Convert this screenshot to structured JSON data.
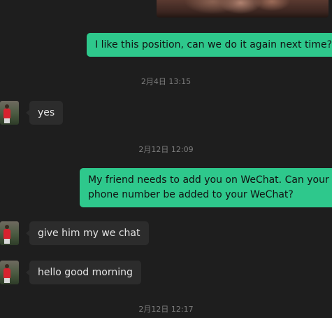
{
  "conversation": {
    "messages": [
      {
        "type": "image",
        "direction": "outgoing"
      },
      {
        "type": "text",
        "direction": "outgoing",
        "text": "I like this position, can we do it again next time?"
      },
      {
        "type": "timestamp",
        "text": "2月4日 13:15"
      },
      {
        "type": "text",
        "direction": "incoming",
        "text": "yes"
      },
      {
        "type": "timestamp",
        "text": "2月12日 12:09"
      },
      {
        "type": "text",
        "direction": "outgoing",
        "lines": [
          "My friend needs to add you on WeChat. Can your",
          "phone number be added to your WeChat?"
        ]
      },
      {
        "type": "text",
        "direction": "incoming",
        "text": "give him my we chat"
      },
      {
        "type": "text",
        "direction": "incoming",
        "text": "hello good morning"
      },
      {
        "type": "timestamp",
        "text": "2月12日 12:17"
      }
    ]
  },
  "colors": {
    "background": "#1e1e1e",
    "outgoing_bubble": "#2ec88c",
    "incoming_bubble": "#2c2c2c",
    "timestamp_text": "#7d7d7d"
  }
}
